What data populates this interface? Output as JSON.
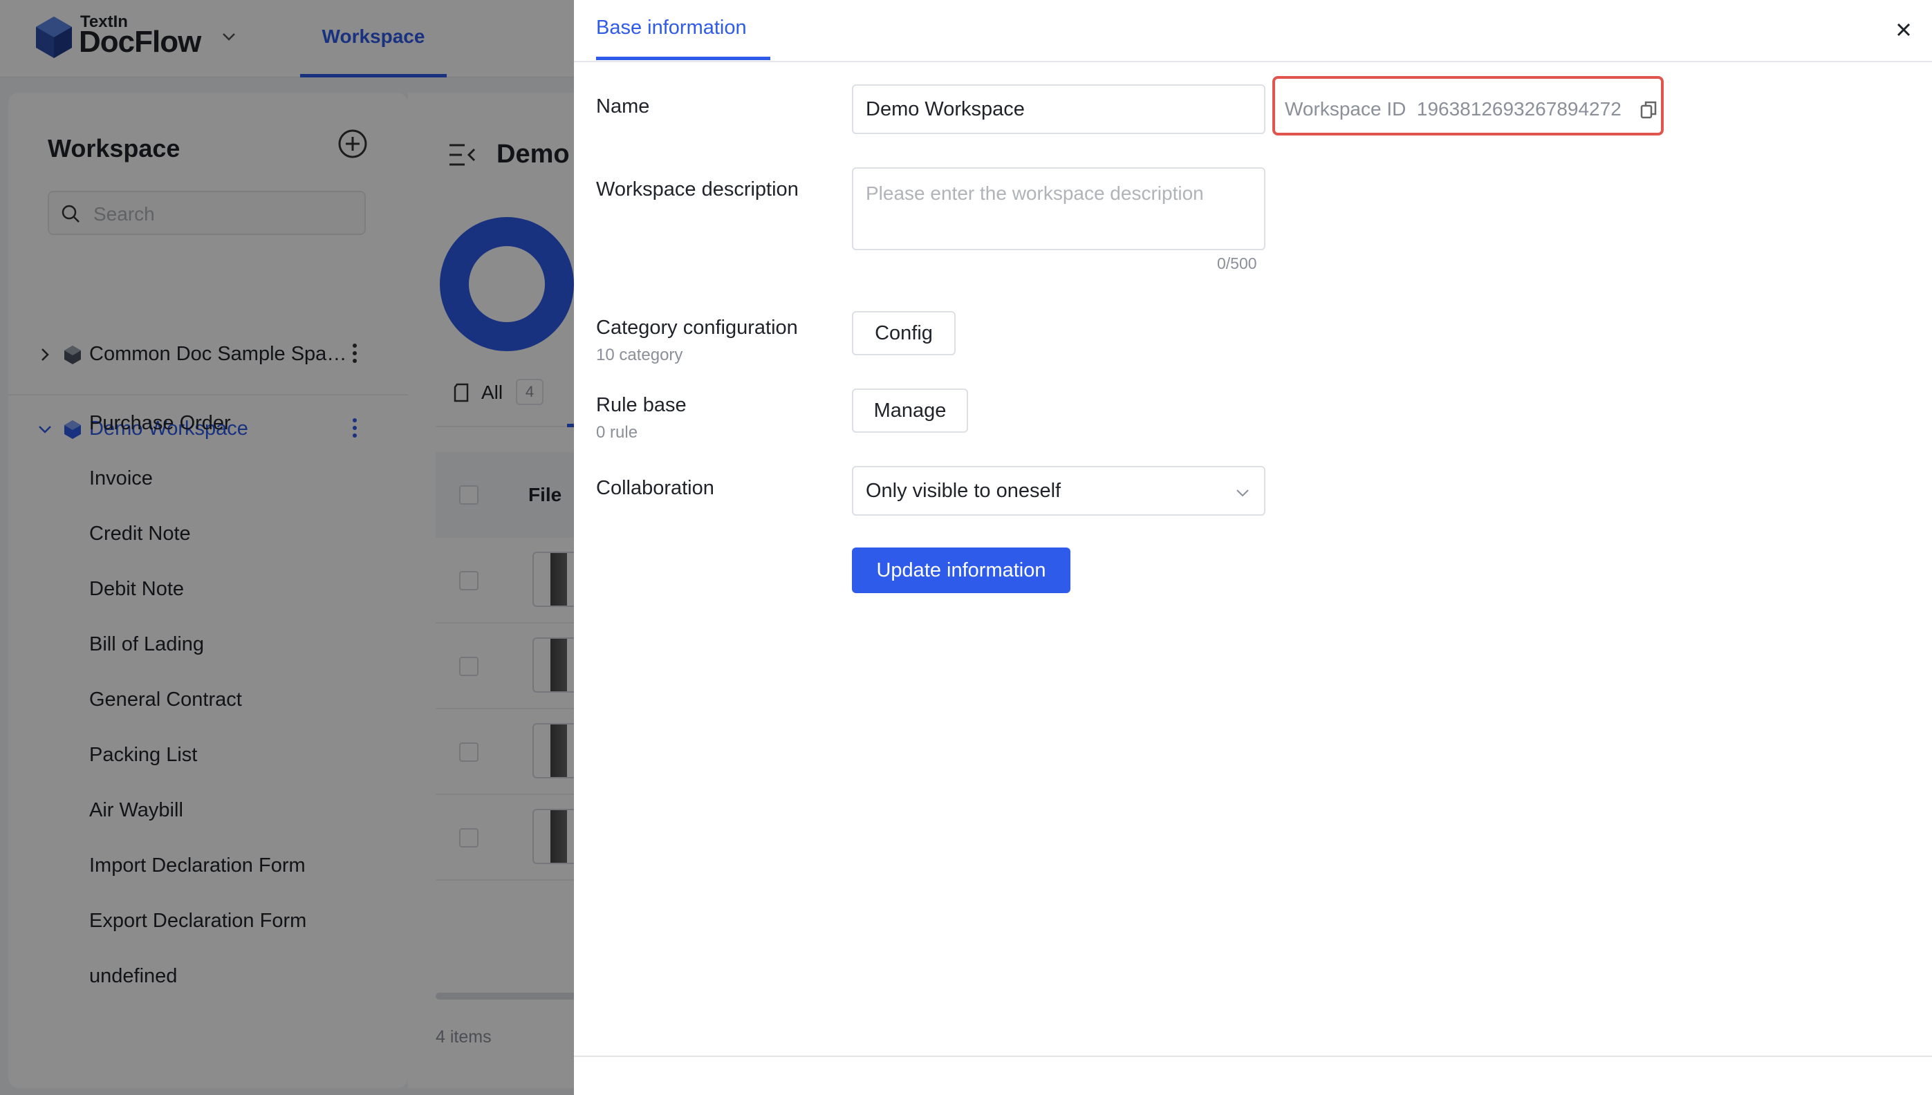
{
  "app": {
    "logo_small": "TextIn",
    "logo_big": "DocFlow",
    "nav_tab": "Workspace"
  },
  "sidebar": {
    "title": "Workspace",
    "search_placeholder": "Search",
    "workspaces": [
      {
        "label": "Common Doc Sample Spa…",
        "expanded": false
      },
      {
        "label": "Demo Workspace",
        "expanded": true
      }
    ],
    "categories": [
      "Purchase Order",
      "Invoice",
      "Credit Note",
      "Debit Note",
      "Bill of Lading",
      "General Contract",
      "Packing List",
      "Air Waybill",
      "Import Declaration Form",
      "Export Declaration Form",
      "undefined"
    ]
  },
  "main": {
    "title": "Demo",
    "tab_all": "All",
    "tab_all_count": "4",
    "col_file": "File",
    "items_count": "4 items"
  },
  "drawer": {
    "tab": "Base information",
    "name_label": "Name",
    "name_value": "Demo Workspace",
    "workspace_id_label": "Workspace ID",
    "workspace_id_value": "1963812693267894272",
    "description_label": "Workspace description",
    "description_placeholder": "Please enter the workspace description",
    "description_counter": "0/500",
    "category_label": "Category configuration",
    "category_sub": "10 category",
    "config_button": "Config",
    "rule_label": "Rule base",
    "rule_sub": "0 rule",
    "manage_button": "Manage",
    "collab_label": "Collaboration",
    "collab_value": "Only visible to oneself",
    "update_button": "Update information"
  },
  "colors": {
    "accent": "#2f5bea",
    "highlight_border": "#e0564f"
  }
}
